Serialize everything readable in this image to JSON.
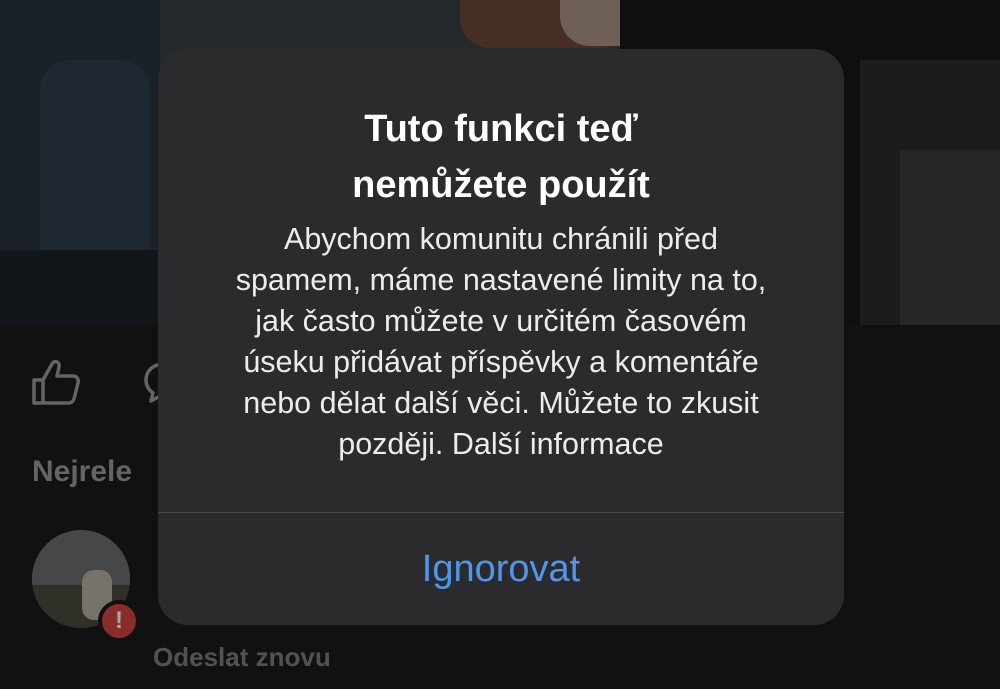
{
  "post_actions": {
    "like_icon": "thumbs-up-icon",
    "comment_icon": "comment-bubble-icon"
  },
  "comments": {
    "sort_label": "Nejrele",
    "failed_comment": {
      "error_badge": "!",
      "resend_label": "Odeslat znovu"
    }
  },
  "alert": {
    "title_line1": "Tuto funkci teď",
    "title_line2": "nemůžete použít",
    "message_lines": [
      "Abychom komunitu chránili před",
      "spamem, máme nastavené limity na to,",
      "jak často můžete v určitém časovém",
      "úseku přidávat příspěvky a komentáře",
      "nebo dělat další věci. Můžete to zkusit",
      "později. Další informace"
    ],
    "button_label": "Ignorovat"
  },
  "colors": {
    "alert_background": "#2b2b2d",
    "button_text": "#4f97ea",
    "error_badge": "#d4443f"
  }
}
